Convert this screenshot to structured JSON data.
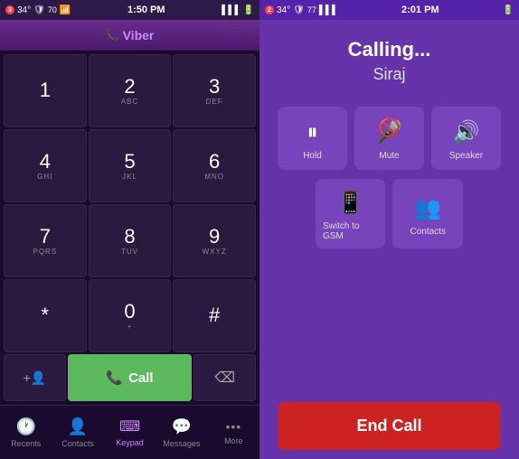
{
  "left": {
    "statusBar": {
      "time": "1:50 PM",
      "signalNum": "3",
      "temp": "34°",
      "shieldNum": "70",
      "batteryIcon": "🔋"
    },
    "header": {
      "title": "Viber"
    },
    "dialpad": {
      "keys": [
        {
          "num": "1",
          "letters": ""
        },
        {
          "num": "2",
          "letters": "ABC"
        },
        {
          "num": "3",
          "letters": "DEF"
        },
        {
          "num": "4",
          "letters": "GHI"
        },
        {
          "num": "5",
          "letters": "JKL"
        },
        {
          "num": "6",
          "letters": "MNO"
        },
        {
          "num": "7",
          "letters": "PQRS"
        },
        {
          "num": "8",
          "letters": "TUV"
        },
        {
          "num": "9",
          "letters": "WXYZ"
        },
        {
          "num": "*",
          "letters": ""
        },
        {
          "num": "0",
          "letters": "+"
        },
        {
          "num": "#",
          "letters": ""
        }
      ]
    },
    "actions": {
      "addContact": "+👤",
      "call": "📞 Call",
      "backspace": "⌫"
    },
    "nav": [
      {
        "id": "recents",
        "label": "Recents",
        "icon": "🕐",
        "active": false
      },
      {
        "id": "contacts",
        "label": "Contacts",
        "icon": "👤",
        "active": false
      },
      {
        "id": "keypad",
        "label": "Keypad",
        "icon": "⌨",
        "active": true
      },
      {
        "id": "messages",
        "label": "Messages",
        "icon": "💬",
        "active": false
      },
      {
        "id": "more",
        "label": "More",
        "icon": "···",
        "active": false
      }
    ]
  },
  "right": {
    "statusBar": {
      "time": "2:01 PM",
      "signalNum": "2",
      "temp": "34°",
      "batteryLevel": "77"
    },
    "calling": {
      "status": "Calling...",
      "name": "Siraj"
    },
    "controls": [
      {
        "id": "hold",
        "label": "Hold",
        "icon": "⏸"
      },
      {
        "id": "mute",
        "label": "Mute",
        "icon": "🎤"
      },
      {
        "id": "speaker",
        "label": "Speaker",
        "icon": "🔊"
      },
      {
        "id": "switch-to-gsm",
        "label": "Switch to GSM",
        "icon": "📱"
      },
      {
        "id": "contacts",
        "label": "Contacts",
        "icon": "👥"
      }
    ],
    "endCall": {
      "label": "End Call"
    }
  }
}
